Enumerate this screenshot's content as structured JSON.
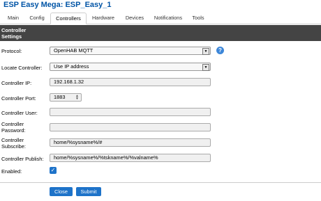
{
  "app": {
    "title": "ESP Easy Mega: ESP_Easy_1"
  },
  "tabs": [
    {
      "label": "Main"
    },
    {
      "label": "Config"
    },
    {
      "label": "Controllers"
    },
    {
      "label": "Hardware"
    },
    {
      "label": "Devices"
    },
    {
      "label": "Notifications"
    },
    {
      "label": "Tools"
    }
  ],
  "active_tab": "Controllers",
  "section": {
    "title": "Controller Settings"
  },
  "form": {
    "protocol": {
      "label": "Protocol:",
      "value": "OpenHAB MQTT"
    },
    "locate": {
      "label": "Locate Controller:",
      "value": "Use IP address"
    },
    "ip": {
      "label": "Controller IP:",
      "value": "192.168.1.32"
    },
    "port": {
      "label": "Controller Port:",
      "value": "1883"
    },
    "user": {
      "label": "Controller User:",
      "value": ""
    },
    "password": {
      "label": "Controller Password:",
      "value": ""
    },
    "subscribe": {
      "label": "Controller Subscribe:",
      "value": "home/%sysname%/#"
    },
    "publish": {
      "label": "Controller Publish:",
      "value": "home/%sysname%/%tskname%/%valname%"
    },
    "enabled": {
      "label": "Enabled:",
      "checked": true
    }
  },
  "help_icon": "?",
  "buttons": {
    "close": "Close",
    "submit": "Submit"
  },
  "colors": {
    "accent": "#1e73c9",
    "title": "#0054a6",
    "header_bg": "#444444"
  }
}
